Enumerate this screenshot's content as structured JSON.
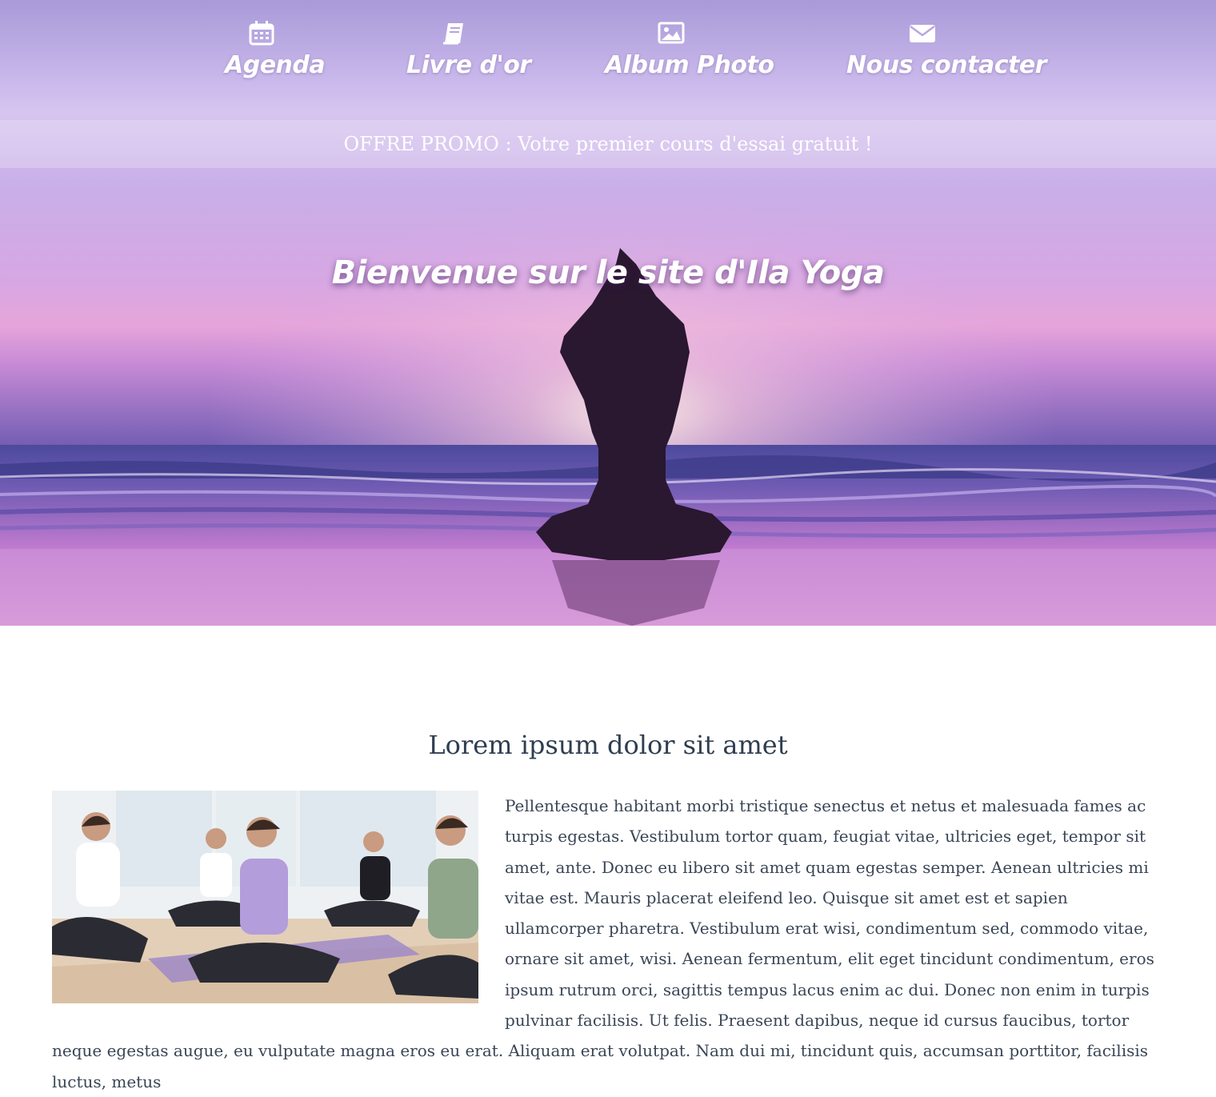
{
  "nav": {
    "items": [
      {
        "label": "Agenda",
        "icon": "calendar-icon"
      },
      {
        "label": "Livre d'or",
        "icon": "book-icon"
      },
      {
        "label": "Album Photo",
        "icon": "image-icon"
      },
      {
        "label": "Nous contacter",
        "icon": "envelope-icon"
      }
    ]
  },
  "promo": {
    "text": "OFFRE PROMO : Votre premier cours d'essai gratuit !"
  },
  "hero": {
    "title": "Bienvenue sur le site d'Ila Yoga"
  },
  "content": {
    "heading": "Lorem ipsum dolor sit amet",
    "paragraph": "Pellentesque habitant morbi tristique senectus et netus et malesuada fames ac turpis egestas. Vestibulum tortor quam, feugiat vitae, ultricies eget, tempor sit amet, ante. Donec eu libero sit amet quam egestas semper. Aenean ultricies mi vitae est. Mauris placerat eleifend leo. Quisque sit amet est et sapien ullamcorper pharetra. Vestibulum erat wisi, condimentum sed, commodo vitae, ornare sit amet, wisi. Aenean fermentum, elit eget tincidunt condimentum, eros ipsum rutrum orci, sagittis tempus lacus enim ac dui. Donec non enim in turpis pulvinar facilisis. Ut felis. Praesent dapibus, neque id cursus faucibus, tortor neque egestas augue, eu vulputate magna eros eu erat. Aliquam erat volutpat. Nam dui mi, tincidunt quis, accumsan porttitor, facilisis luctus, metus"
  },
  "colors": {
    "nav_text": "#ffffff",
    "heading_text": "#2f3e50",
    "body_text": "#3a4656",
    "hero_purple": "#c9aee8"
  }
}
